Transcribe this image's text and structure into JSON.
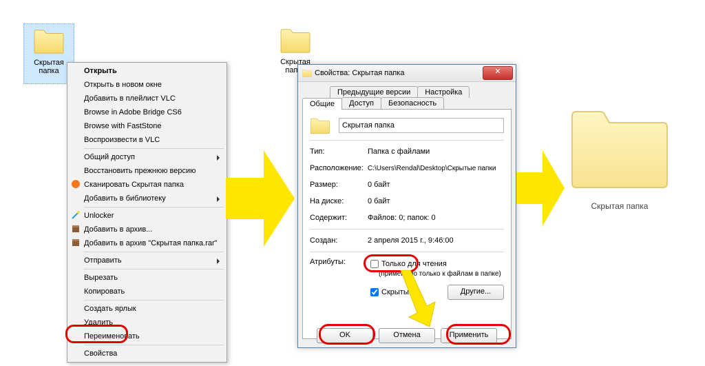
{
  "step1": {
    "folder_label": "Скрытая папка"
  },
  "context_menu": {
    "open": "Открыть",
    "open_new_window": "Открыть в новом окне",
    "add_vlc_playlist": "Добавить в плейлист VLC",
    "browse_bridge": "Browse in Adobe Bridge CS6",
    "browse_faststone": "Browse with FastStone",
    "play_vlc": "Воспроизвести в VLC",
    "share": "Общий доступ",
    "restore_prev": "Восстановить прежнюю версию",
    "scan": "Сканировать Скрытая папка",
    "add_library": "Добавить в библиотеку",
    "unlocker": "Unlocker",
    "add_archive": "Добавить в архив...",
    "add_archive_rar": "Добавить в архив \"Скрытая папка.rar\"",
    "send_to": "Отправить",
    "cut": "Вырезать",
    "copy": "Копировать",
    "create_shortcut": "Создать ярлык",
    "delete": "Удалить",
    "rename": "Переименовать",
    "properties": "Свойства"
  },
  "step2": {
    "folder_label": "Скрытая папка"
  },
  "dialog": {
    "title": "Свойства: Скрытая папка",
    "tabs": {
      "previous": "Предыдущие версии",
      "settings": "Настройка",
      "general": "Общие",
      "access": "Доступ",
      "security": "Безопасность"
    },
    "name_value": "Скрытая папка",
    "type_label": "Тип:",
    "type_value": "Папка с файлами",
    "location_label": "Расположение:",
    "location_value": "C:\\Users\\Rendal\\Desktop\\Скрытые папки",
    "size_label": "Размер:",
    "size_value": "0 байт",
    "ondisk_label": "На диске:",
    "ondisk_value": "0 байт",
    "contains_label": "Содержит:",
    "contains_value": "Файлов: 0; папок: 0",
    "created_label": "Создан:",
    "created_value": "2 апреля 2015 г., 9:46:00",
    "attrs_label": "Атрибуты:",
    "readonly_label": "Только для чтения",
    "readonly_note": "(применимо только к файлам в папке)",
    "hidden_label": "Скрытый",
    "other_btn": "Другие...",
    "ok": "OK",
    "cancel": "Отмена",
    "apply": "Применить"
  },
  "step3": {
    "folder_label": "Скрытая папка"
  }
}
